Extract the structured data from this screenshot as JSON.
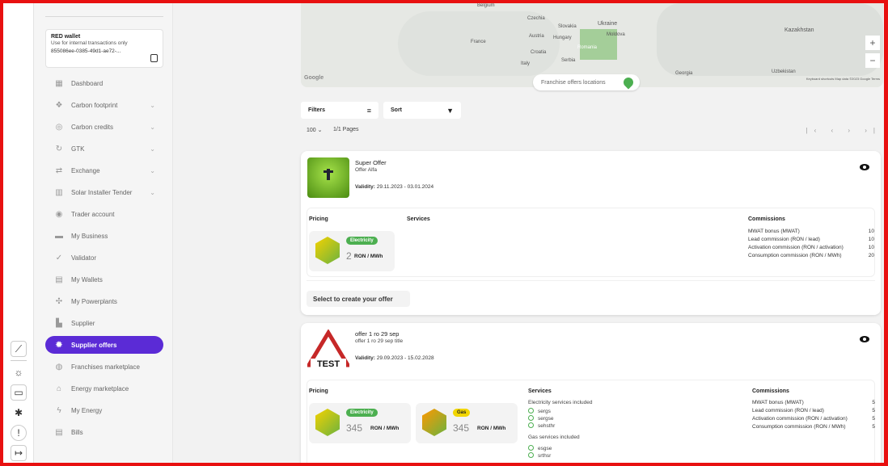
{
  "colors": {
    "accent": "#5b2bd6",
    "frame": "#e81010",
    "electricity": "#4caf50",
    "gas": "#f2d600"
  },
  "wallet": {
    "title": "RED wallet",
    "subtitle": "Use for internal transactions only",
    "id": "855086ee-0385-49d1-ae72-..."
  },
  "sidebar": {
    "items": [
      {
        "label": "Dashboard",
        "icon": "dashboard-icon",
        "chevron": false
      },
      {
        "label": "Carbon footprint",
        "icon": "footprint-icon",
        "chevron": true
      },
      {
        "label": "Carbon credits",
        "icon": "co2-icon",
        "chevron": true
      },
      {
        "label": "GTK",
        "icon": "refresh-icon",
        "chevron": true
      },
      {
        "label": "Exchange",
        "icon": "exchange-icon",
        "chevron": true
      },
      {
        "label": "Solar Installer Tender",
        "icon": "solar-icon",
        "chevron": true
      },
      {
        "label": "Trader account",
        "icon": "trader-icon",
        "chevron": false
      },
      {
        "label": "My Business",
        "icon": "briefcase-icon",
        "chevron": false
      },
      {
        "label": "Validator",
        "icon": "check-icon",
        "chevron": false
      },
      {
        "label": "My Wallets",
        "icon": "wallet-icon",
        "chevron": false
      },
      {
        "label": "My Powerplants",
        "icon": "turbine-icon",
        "chevron": false
      },
      {
        "label": "Supplier",
        "icon": "factory-icon",
        "chevron": false
      },
      {
        "label": "Supplier offers",
        "icon": "gear-icon",
        "chevron": false,
        "active": true
      },
      {
        "label": "Franchises marketplace",
        "icon": "store-icon",
        "chevron": false
      },
      {
        "label": "Energy marketplace",
        "icon": "basket-icon",
        "chevron": false
      },
      {
        "label": "My Energy",
        "icon": "energy-icon",
        "chevron": false
      },
      {
        "label": "Bills",
        "icon": "bill-icon",
        "chevron": false
      }
    ]
  },
  "map": {
    "labels": [
      "Belgium",
      "Czechia",
      "Slovakia",
      "Ukraine",
      "Kazakhstan",
      "France",
      "Austria",
      "Hungary",
      "Moldova",
      "Romania",
      "Croatia",
      "Serbia",
      "Italy",
      "Georgia",
      "Uzbekistan",
      "Google"
    ],
    "attribution": "Keyboard shortcuts   Map data ©2023 Google   Terms",
    "zoom_in": "+",
    "zoom_out": "−",
    "franchise_label": "Franchise offers locations"
  },
  "toolbar": {
    "filters": "Filters",
    "sort": "Sort"
  },
  "pager": {
    "page_size": "100",
    "pages": "1/1 Pages",
    "nav": "|‹ ‹ › ›|"
  },
  "offers": [
    {
      "title": "Super Offer",
      "subtitle": "Offer Alfa",
      "validity_label": "Validity:",
      "validity": "29.11.2023 - 03.01.2024",
      "pricing_label": "Pricing",
      "services_label": "Services",
      "commissions_label": "Commissions",
      "prices": [
        {
          "tag": "Electricity",
          "value": "2",
          "unit": "RON / MWh"
        }
      ],
      "commissions": [
        {
          "label": "MWAT bonus (MWAT)",
          "value": "10"
        },
        {
          "label": "Lead commission (RON / lead)",
          "value": "10"
        },
        {
          "label": "Activation commission (RON / activation)",
          "value": "10"
        },
        {
          "label": "Consumption commission (RON / MWh)",
          "value": "20"
        }
      ],
      "select_label": "Select to create your offer"
    },
    {
      "title": "offer 1 ro 29 sep",
      "subtitle": "offer 1 ro 29 sep title",
      "validity_label": "Validity:",
      "validity": "29.09.2023 - 15.02.2028",
      "logo_text": "TEST",
      "pricing_label": "Pricing",
      "services_label": "Services",
      "commissions_label": "Commissions",
      "prices": [
        {
          "tag": "Electricity",
          "value": "345",
          "unit": "RON / MWh"
        },
        {
          "tag": "Gas",
          "value": "345",
          "unit": "RON / MWh"
        }
      ],
      "electricity_services_label": "Electricity services included",
      "electricity_services": [
        "sergs",
        "sergse",
        "sehsthr"
      ],
      "gas_services_label": "Gas services included",
      "gas_services": [
        "esgse",
        "srthsr"
      ],
      "commissions": [
        {
          "label": "MWAT bonus (MWAT)",
          "value": "5"
        },
        {
          "label": "Lead commission (RON / lead)",
          "value": "5"
        },
        {
          "label": "Activation commission (RON / activation)",
          "value": "5"
        },
        {
          "label": "Consumption commission (RON / MWh)",
          "value": "5"
        }
      ]
    }
  ]
}
